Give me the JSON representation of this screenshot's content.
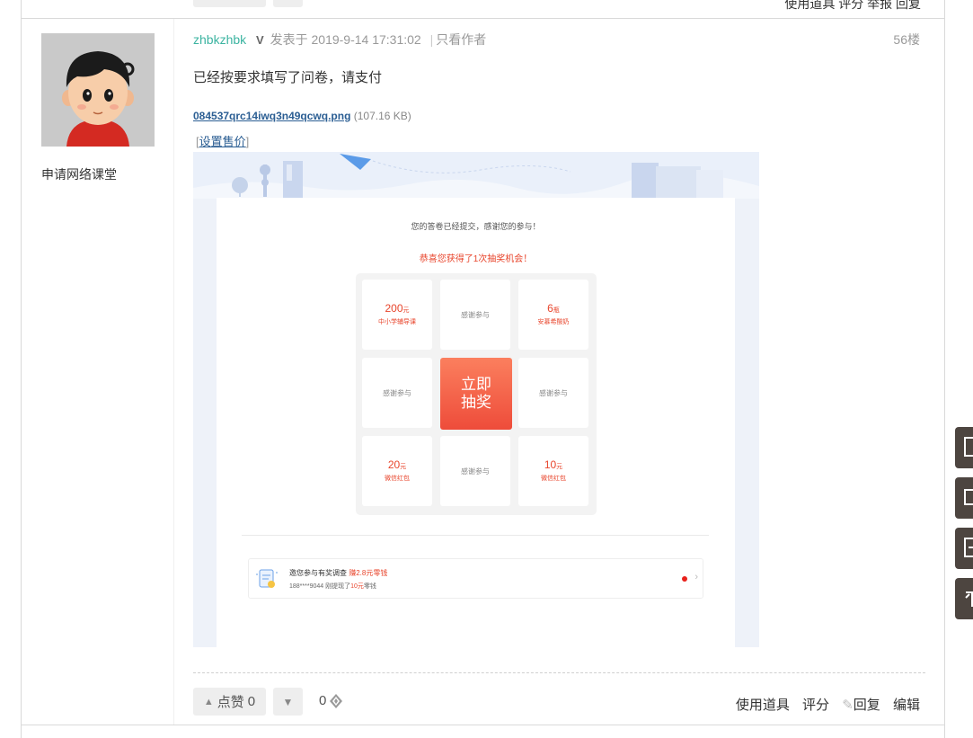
{
  "prev_post": {
    "actions": "使用道具  评分  举报  回复"
  },
  "author": {
    "group": "申请网络课堂"
  },
  "post": {
    "username": "zhbkzhbk",
    "posted_prefix": "发表于",
    "posted_time": "2019-9-14 17:31:02",
    "only_author": "只看作者",
    "floor": "56楼",
    "content": "已经按要求填写了问卷，请支付",
    "attachment": {
      "filename": "084537qrc14iwq3n49qcwq.png",
      "size": "(107.16 KB)"
    },
    "set_price": "设置售价"
  },
  "screenshot": {
    "thanks_text": "您的答卷已经提交，感谢您的参与！",
    "congrats_text": "恭喜您获得了1次抽奖机会！",
    "prizes": [
      {
        "amount": "200",
        "unit": "元",
        "desc": "中小学辅导课"
      },
      {
        "thanks": "感谢参与"
      },
      {
        "amount": "6",
        "unit": "瓶",
        "desc": "安慕希酸奶"
      },
      {
        "thanks": "感谢参与"
      },
      {
        "thanks": "感谢参与"
      },
      {
        "amount": "20",
        "unit": "元",
        "desc": "微信红包"
      },
      {
        "thanks": "感谢参与"
      },
      {
        "amount": "10",
        "unit": "元",
        "desc": "微信红包"
      }
    ],
    "draw_button": {
      "line1": "立即",
      "line2": "抽奖"
    },
    "survey": {
      "title": "邀您参与有奖调查",
      "reward": "赚2.8元零钱",
      "line2_prefix": "188****9044 刚提现了",
      "line2_amount": "10元",
      "line2_suffix": "零钱"
    }
  },
  "footer": {
    "like_label": "点赞",
    "like_count": "0",
    "rate_count": "0",
    "use_tool": "使用道具",
    "rate": "评分",
    "reply": "回复",
    "edit": "编辑"
  },
  "colors": {
    "accent_teal": "#3cb4a1",
    "link_blue": "#2b5e93",
    "prize_red": "#e8452c",
    "float_bg": "#4d4540"
  }
}
